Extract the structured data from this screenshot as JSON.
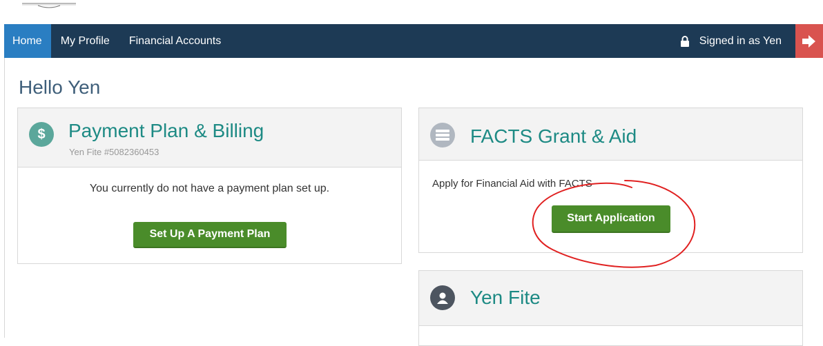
{
  "nav": {
    "items": [
      {
        "label": "Home",
        "active": true
      },
      {
        "label": "My Profile",
        "active": false
      },
      {
        "label": "Financial Accounts",
        "active": false
      }
    ],
    "signed_in_text": "Signed in as Yen",
    "lock_icon": "lock-icon",
    "logout_icon": "sign-out-icon",
    "colors": {
      "navbar": "#1d3a55",
      "active": "#2a7ec2",
      "logout": "#d9534f"
    }
  },
  "page": {
    "greeting": "Hello Yen"
  },
  "payment_panel": {
    "icon": "dollar-icon",
    "title": "Payment Plan & Billing",
    "subtitle": "Yen Fite #5082360453",
    "message": "You currently do not have a payment plan set up.",
    "button_label": "Set Up A Payment Plan"
  },
  "grant_panel": {
    "icon": "server-icon",
    "title": "FACTS Grant & Aid",
    "message": "Apply for Financial Aid with FACTS",
    "button_label": "Start Application"
  },
  "profile_panel": {
    "icon": "user-icon",
    "title": "Yen Fite"
  },
  "colors": {
    "accent_teal": "#1d8a84",
    "button_green": "#4a8c2a",
    "annotation_red": "#e02020"
  }
}
